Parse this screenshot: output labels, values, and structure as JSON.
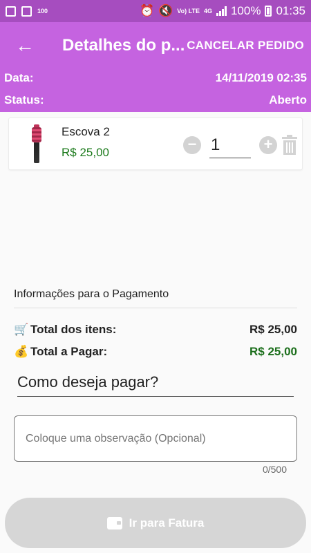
{
  "status_bar": {
    "lte_label": "Vo) LTE",
    "network": "4G",
    "battery": "100%",
    "time": "01:35",
    "small_badge": "100"
  },
  "header": {
    "title": "Detalhes do p...",
    "cancel_label": "CANCELAR PEDIDO",
    "date_label": "Data:",
    "date_value": "14/11/2019 02:35",
    "status_label": "Status:",
    "status_value": "Aberto"
  },
  "cart": {
    "items": [
      {
        "name": "Escova 2",
        "price": "R$ 25,00",
        "quantity": "1"
      }
    ]
  },
  "payment": {
    "section_title": "Informações para o Pagamento",
    "total_items_label": "Total dos itens:",
    "total_items_value": "R$ 25,00",
    "total_pay_label": "Total a Pagar:",
    "total_pay_value": "R$ 25,00",
    "method_prompt": "Como deseja pagar?",
    "observation_placeholder": "Coloque uma observação (Opcional)",
    "char_counter": "0/500",
    "invoice_button": "Ir para Fatura"
  },
  "colors": {
    "status_bar": "#a64dbf",
    "app_bar": "#c563e0",
    "price_green": "#1b7a1b",
    "disabled_button": "#d6d6d6"
  }
}
